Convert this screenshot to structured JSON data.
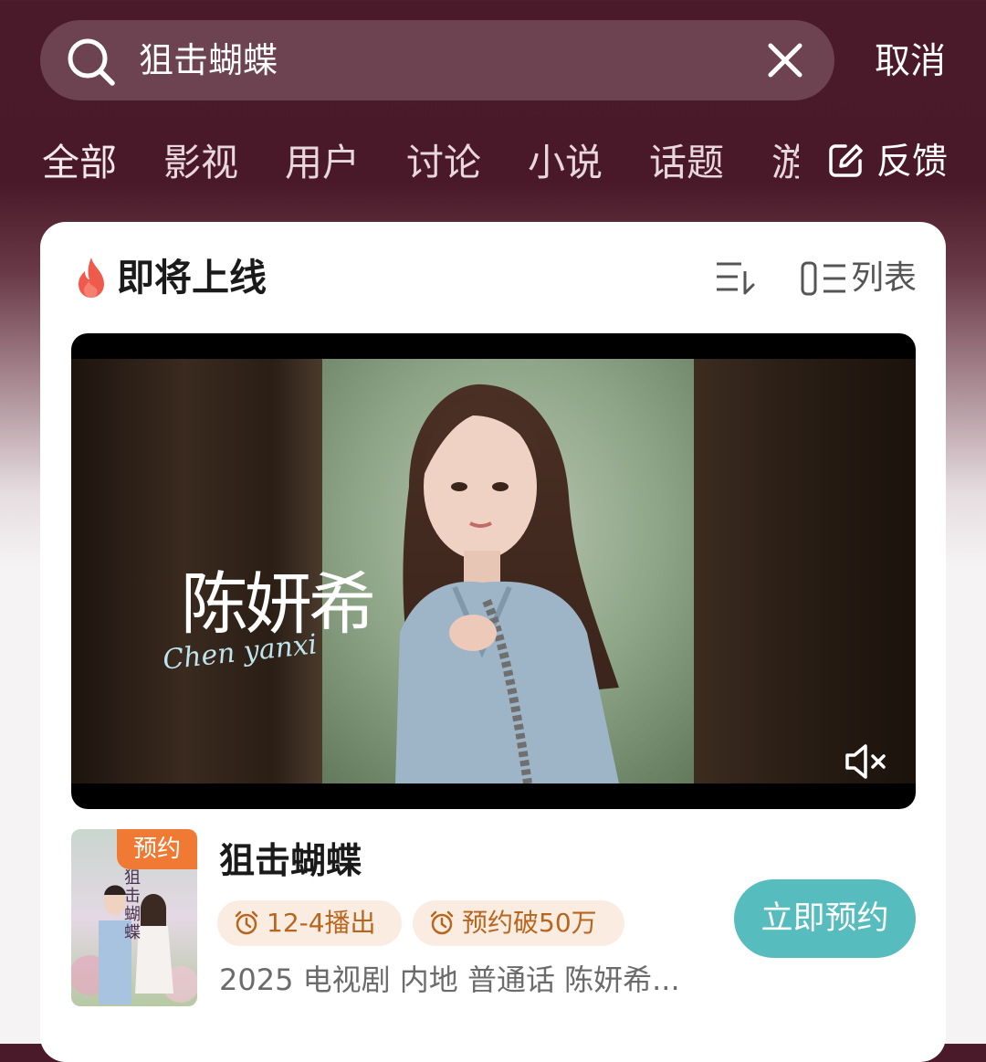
{
  "search": {
    "query": "狙击蝴蝶",
    "cancel_label": "取消"
  },
  "tabs": [
    {
      "label": "全部"
    },
    {
      "label": "影视"
    },
    {
      "label": "用户"
    },
    {
      "label": "讨论"
    },
    {
      "label": "小说"
    },
    {
      "label": "话题"
    },
    {
      "label": "游"
    }
  ],
  "feedback_label": "反馈",
  "section": {
    "title": "即将上线",
    "list_label": "列表"
  },
  "video": {
    "overlay_name": "陈妍希",
    "overlay_pinyin": "Chen yanxi"
  },
  "show": {
    "badge": "预约",
    "title": "狙击蝴蝶",
    "air_date_chip": "12-4播出",
    "reservations_chip": "预约破50万",
    "meta": "2025 电视剧 内地 普通话 陈妍希...",
    "reserve_button": "立即预约",
    "poster_caption": "狙击蝴蝶"
  },
  "colors": {
    "header_bg": "#4b1a2a",
    "reserve_button": "#56bcbe",
    "badge": "#f07a33",
    "chip_text": "#b8651e"
  }
}
